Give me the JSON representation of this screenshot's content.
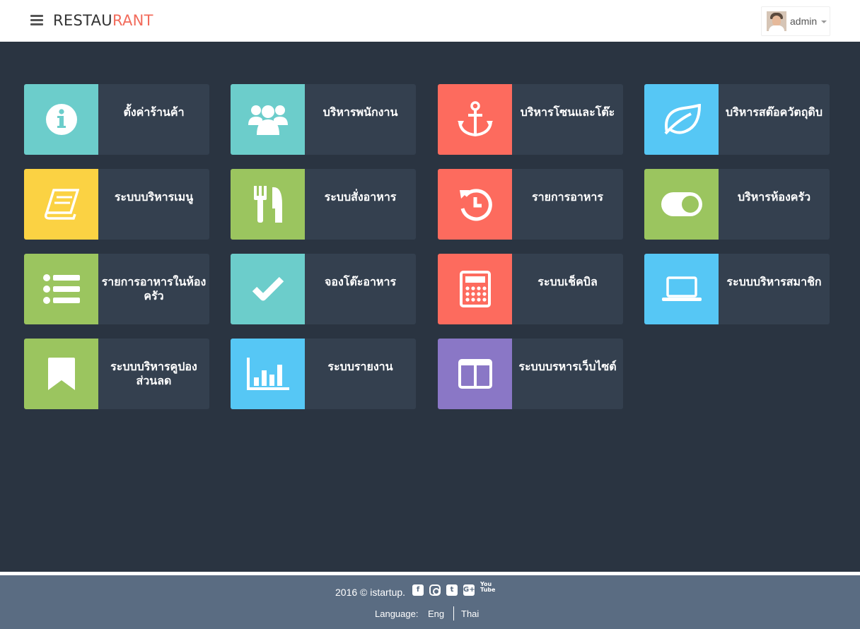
{
  "header": {
    "brand_part1": "RESTAU",
    "brand_part2": "RANT",
    "brand_accent_color": "#f26b5b",
    "user_name": "admin",
    "menu_icon": "hamburger-icon"
  },
  "tiles": [
    {
      "label": "ตั้งค่าร้านค้า",
      "icon": "info-icon",
      "color": "#6ccdcb"
    },
    {
      "label": "บริหารพนักงาน",
      "icon": "users-icon",
      "color": "#6ccdcb"
    },
    {
      "label": "บริหารโซนและโต๊ะ",
      "icon": "anchor-icon",
      "color": "#fd6b5e"
    },
    {
      "label": "บริหารสต๊อควัตถุดิบ",
      "icon": "leaf-icon",
      "color": "#56c7f5"
    },
    {
      "label": "ระบบบริหารเมนู",
      "icon": "book-icon",
      "color": "#fbd243"
    },
    {
      "label": "ระบบสั่งอาหาร",
      "icon": "cutlery-icon",
      "color": "#9bc55f"
    },
    {
      "label": "รายการอาหาร",
      "icon": "history-icon",
      "color": "#fd6b5e"
    },
    {
      "label": "บริหารห้องครัว",
      "icon": "toggle-icon",
      "color": "#9bc55f"
    },
    {
      "label": "รายการอาหารในห้องครัว",
      "icon": "list-icon",
      "color": "#9bc55f"
    },
    {
      "label": "จองโต๊ะอาหาร",
      "icon": "check-icon",
      "color": "#6ccdcb"
    },
    {
      "label": "ระบบเช็คบิล",
      "icon": "calculator-icon",
      "color": "#fd6b5e"
    },
    {
      "label": "ระบบบริหารสมาชิก",
      "icon": "laptop-icon",
      "color": "#56c7f5"
    },
    {
      "label": "ระบบบริหารคูปอง ส่วนลด",
      "icon": "bookmark-icon",
      "color": "#9bc55f"
    },
    {
      "label": "ระบบรายงาน",
      "icon": "bar-chart-icon",
      "color": "#56c7f5"
    },
    {
      "label": "ระบบบรหารเว็บไซต์",
      "icon": "columns-icon",
      "color": "#8a77c6"
    }
  ],
  "footer": {
    "copyright": "2016 © istartup.",
    "social": [
      "facebook-icon",
      "instagram-icon",
      "twitter-icon",
      "google-plus-icon",
      "youtube-icon"
    ],
    "language_label": "Language:",
    "lang_eng": "Eng",
    "lang_thai": "Thai"
  }
}
